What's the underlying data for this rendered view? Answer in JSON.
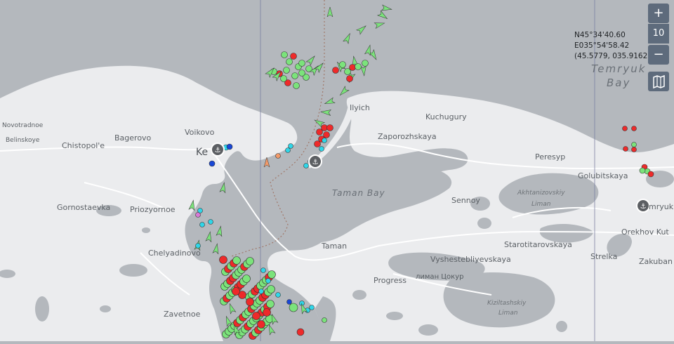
{
  "map": {
    "colors": {
      "water": "#b4b8bd",
      "land": "#ebecee",
      "road": "#ffffff",
      "vessel_green": "#7be37b",
      "vessel_red": "#ee2a2a",
      "vessel_cyan": "#2fd6e8",
      "vessel_blue": "#1947d6",
      "vessel_orange": "#f29a6a",
      "grid": "#7a7fa0"
    },
    "places": {
      "novotradnoe": "Novotradnoe",
      "belinskoye": "Belinskoye",
      "chistopole": "Chistopol'e",
      "bagerovo": "Bagerovo",
      "voikovo": "Voikovo",
      "kerch": "Ke",
      "ilyich": "Ilyich",
      "kuchugury": "Kuchugury",
      "zaporozhskaya": "Zaporozhskaya",
      "peresyp": "Peresyp",
      "golubitskaya": "Golubitskaya",
      "temryuk": "mryuk",
      "gornostaevka": "Gornostaevka",
      "priozyornoe": "Priozyornoe",
      "chelyadinovo": "Chelyadinovo",
      "zavetnoe": "Zavetnoe",
      "taman": "Taman",
      "sennoy": "Sennoy",
      "starotitarovskaya": "Starotitarovskaya",
      "vyshestebliyevskaya": "Vyshestebliyevskaya",
      "progress": "Progress",
      "strelka": "Strelka",
      "orekhov_kut": "Orekhov Kut",
      "zakuban": "Zakuban",
      "taman_bay": "Taman Bay",
      "temryuk_bay_1": "Temryuk",
      "temryuk_bay_2": "Bay",
      "akhtanizovskiy_1": "Akhtanizovskiy",
      "akhtanizovskiy_2": "Liman",
      "kiziltashskiy_1": "Kiziltashskiy",
      "kiziltashskiy_2": "Liman",
      "liman_tsokur": "лиман Цокур"
    },
    "icons": [
      "port-icon",
      "port-icon",
      "port-icon"
    ]
  },
  "coords": {
    "lat": "N45°34'40.60",
    "lon": "E035°54'58.42",
    "decimal": "(45.5779, 035.9162)"
  },
  "controls": {
    "zoom_in": "+",
    "zoom_level": "10",
    "zoom_out": "−",
    "layers_icon": "map-layers-icon"
  }
}
